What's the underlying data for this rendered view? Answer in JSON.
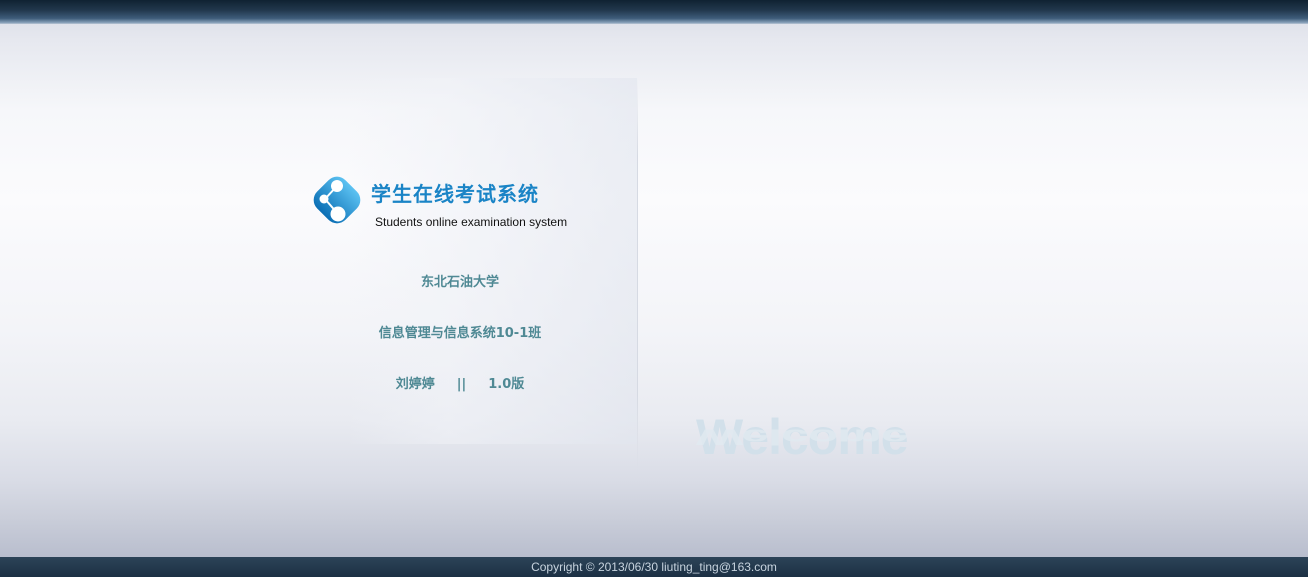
{
  "header": {
    "app_title": "学生在线考试系统",
    "app_subtitle": "Students online examination system"
  },
  "info": {
    "university": "东北石油大学",
    "class_name": "信息管理与信息系统10-1班",
    "author": "刘婷婷",
    "separator": "||",
    "version": "1.0版"
  },
  "welcome": {
    "text": "Welcome"
  },
  "footer": {
    "copyright": "Copyright © 2013/06/30 liuting_ting@163.com"
  },
  "colors": {
    "brand_blue": "#1a84c6",
    "info_text": "#4f8994",
    "top_bar": "#22384d",
    "footer_bar": "#1c3044"
  },
  "icons": {
    "logo": "share-nodes-icon"
  }
}
